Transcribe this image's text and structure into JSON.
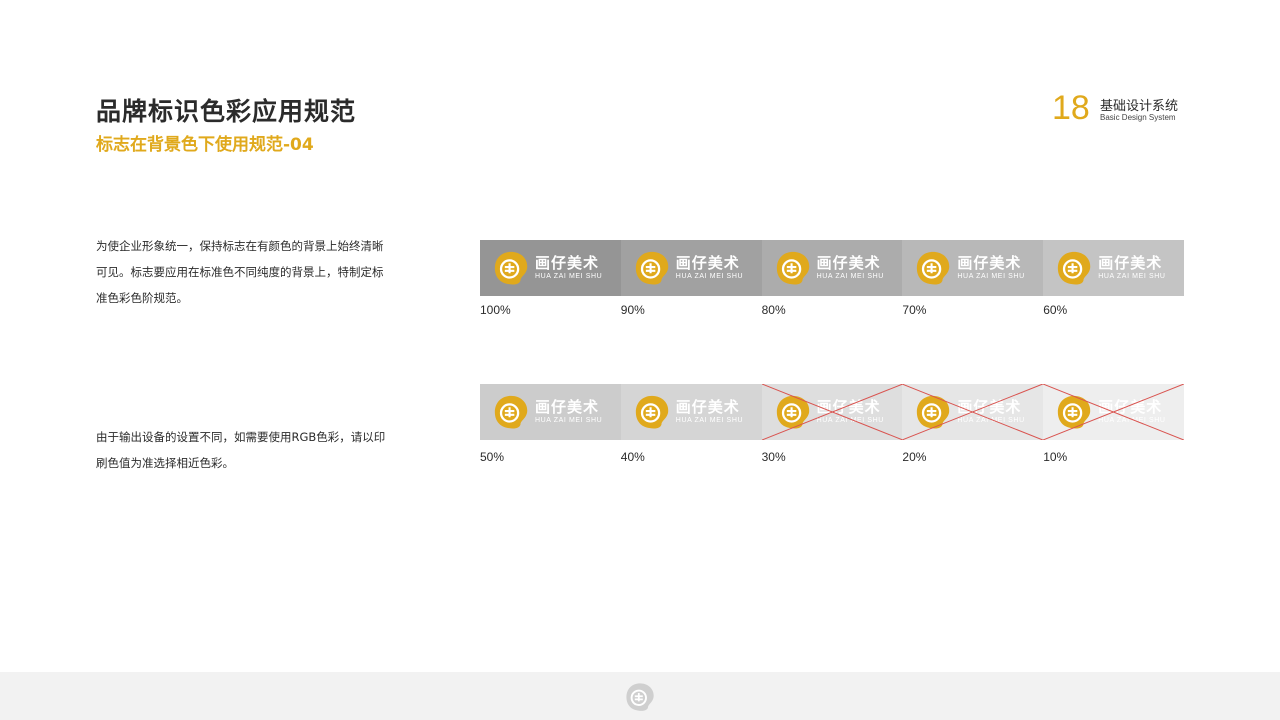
{
  "header": {
    "title": "品牌标识色彩应用规范",
    "subtitle": "标志在背景色下使用规范-04",
    "page_number": "18",
    "system_cn": "基础设计系统",
    "system_en": "Basic Design System"
  },
  "descriptions": {
    "first": "为使企业形象统一，保持标志在有颜色的背景上始终清晰可见。标志要应用在标准色不同纯度的背景上，特制定标准色彩色阶规范。",
    "second": "由于输出设备的设置不同，如需要使用RGB色彩，请以印刷色值为准选择相近色彩。"
  },
  "logo": {
    "name_cn": "画仔美术",
    "name_en": "HUA ZAI MEI SHU",
    "icon": "palette-face-icon",
    "brand_color": "#e0a91c"
  },
  "swatches_row1": [
    {
      "label": "100%",
      "bg": "#959595",
      "invalid": false
    },
    {
      "label": "90%",
      "bg": "#a1a1a1",
      "invalid": false
    },
    {
      "label": "80%",
      "bg": "#acacac",
      "invalid": false
    },
    {
      "label": "70%",
      "bg": "#b8b8b8",
      "invalid": false
    },
    {
      "label": "60%",
      "bg": "#c4c4c4",
      "invalid": false
    }
  ],
  "swatches_row2": [
    {
      "label": "50%",
      "bg": "#cccccc",
      "invalid": false
    },
    {
      "label": "40%",
      "bg": "#d5d5d5",
      "invalid": false
    },
    {
      "label": "30%",
      "bg": "#dedede",
      "invalid": true
    },
    {
      "label": "20%",
      "bg": "#e6e6e6",
      "invalid": true
    },
    {
      "label": "10%",
      "bg": "#eeeeee",
      "invalid": true
    }
  ],
  "colors": {
    "accent": "#e0a91c",
    "cross": "#d9534f",
    "footer_bg": "#f2f2f2"
  }
}
